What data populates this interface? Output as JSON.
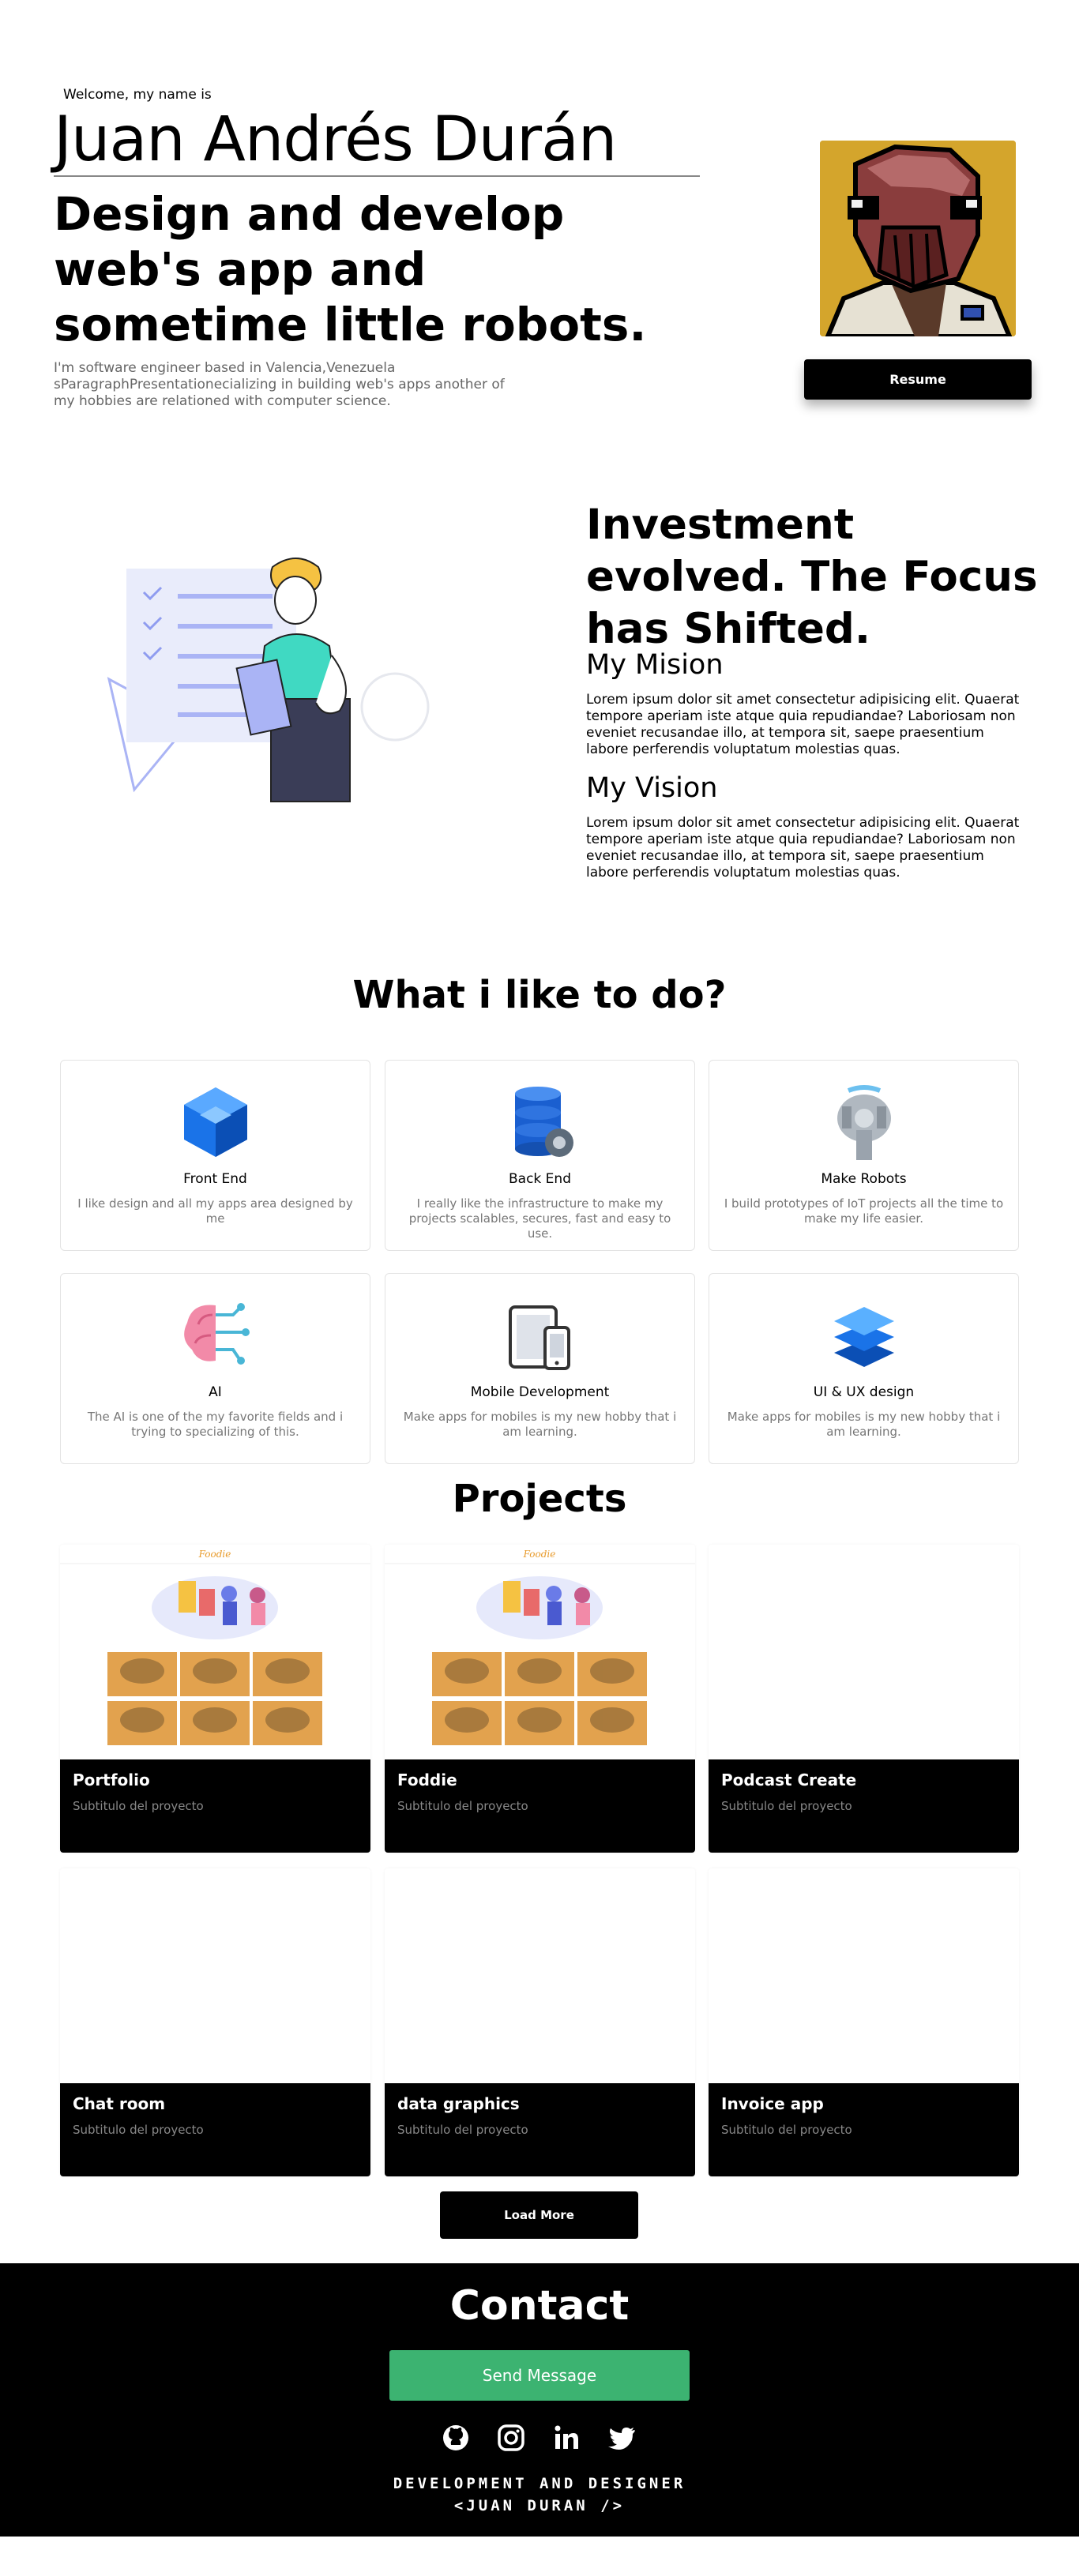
{
  "hero": {
    "welcome": "Welcome, my name is",
    "name": "Juan Andrés Durán",
    "tagline": "Design and develop web's app and sometime little robots.",
    "description": "I'm software engineer based in Valencia,Venezuela sParagraphPresentationecializing in building web's apps another of my hobbies are relationed with computer science.",
    "resume_label": "Resume"
  },
  "about": {
    "title": "Investment evolved. The Focus has Shifted.",
    "mision_heading": "My Mision",
    "mision_text": "Lorem ipsum dolor sit amet consectetur adipisicing elit. Quaerat tempore aperiam iste atque quia repudiandae? Laboriosam non eveniet recusandae illo, at tempora sit, saepe praesentium labore perferendis voluptatum molestias quas.",
    "vision_heading": "My Vision",
    "vision_text": "Lorem ipsum dolor sit amet consectetur adipisicing elit. Quaerat tempore aperiam iste atque quia repudiandae? Laboriosam non eveniet recusandae illo, at tempora sit, saepe praesentium labore perferendis voluptatum molestias quas."
  },
  "skills": {
    "title": "What i like to do?",
    "items": [
      {
        "title": "Front End",
        "desc": "I like design and all my apps area designed by me",
        "icon": "cube-icon"
      },
      {
        "title": "Back End",
        "desc": "I really like the infrastructure to make my projects scalables, secures, fast and easy to use.",
        "icon": "database-gear-icon"
      },
      {
        "title": "Make Robots",
        "desc": "I build prototypes of IoT projects all the time to make my life easier.",
        "icon": "spaceship-icon"
      },
      {
        "title": "AI",
        "desc": "The AI is one of the my favorite fields and i trying to specializing of this.",
        "icon": "brain-circuit-icon"
      },
      {
        "title": "Mobile Development",
        "desc": "Make apps for mobiles is my new hobby that i am learning.",
        "icon": "devices-icon"
      },
      {
        "title": "UI & UX design",
        "desc": "Make apps for mobiles is my new hobby that i am learning.",
        "icon": "layers-icon"
      }
    ]
  },
  "projects": {
    "title": "Projects",
    "items": [
      {
        "title": "Portfolio",
        "subtitle": "Subtitulo del proyecto",
        "brand": "Foodie"
      },
      {
        "title": "Foddie",
        "subtitle": "Subtitulo del proyecto",
        "brand": "Foodie"
      },
      {
        "title": "Podcast Create",
        "subtitle": "Subtitulo del proyecto"
      },
      {
        "title": "Chat room",
        "subtitle": "Subtitulo del proyecto"
      },
      {
        "title": "data graphics",
        "subtitle": "Subtitulo del proyecto"
      },
      {
        "title": "Invoice app",
        "subtitle": "Subtitulo del proyecto"
      }
    ],
    "load_more_label": "Load More"
  },
  "contact": {
    "title": "Contact",
    "send_label": "Send Message",
    "socials": [
      "github-icon",
      "instagram-icon",
      "linkedin-icon",
      "twitter-icon"
    ],
    "footer_line1": "DEVELOPMENT AND DESIGNER",
    "footer_line2": "<JUAN DURAN />"
  },
  "colors": {
    "accent_green": "#3cb371",
    "avatar_bg": "#d4a52c",
    "illustration_teal": "#40d9c2",
    "illustration_lavender": "#aab4f5"
  }
}
